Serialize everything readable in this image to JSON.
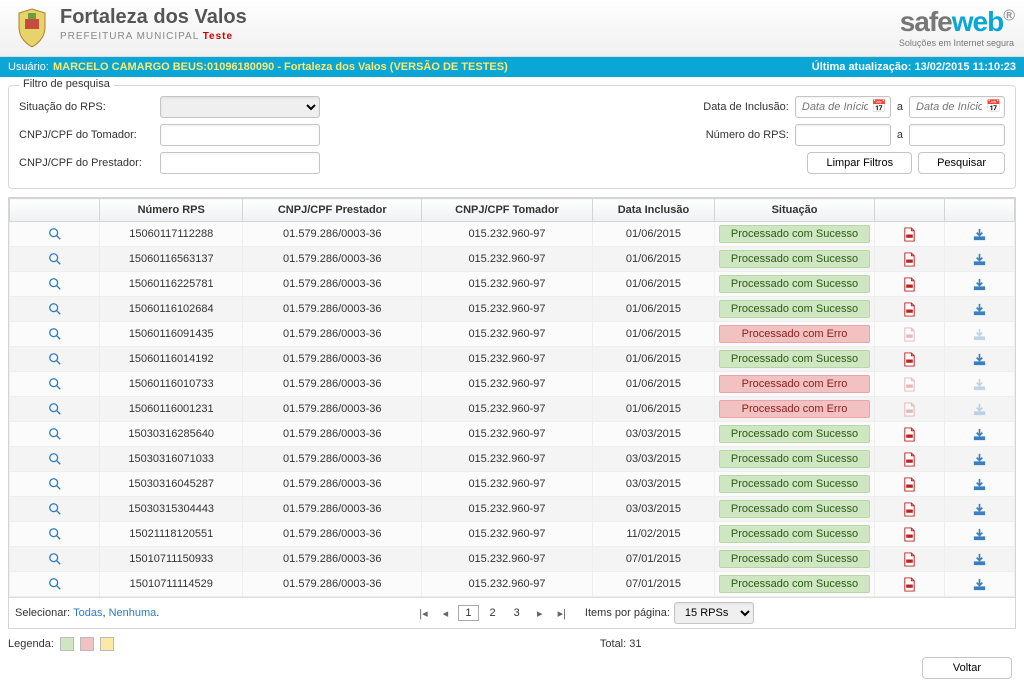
{
  "header": {
    "title": "Fortaleza dos Valos",
    "subtitle": "PREFEITURA MUNICIPAL",
    "teste": "Teste",
    "logo_tag": "Soluções em Internet segura"
  },
  "userbar": {
    "label": "Usuário:",
    "value": "MARCELO CAMARGO BEUS:01096180090 - Fortaleza dos Valos (VERSÃO DE TESTES)",
    "update": "Última atualização: 13/02/2015 11:10:23"
  },
  "filter": {
    "legend": "Filtro de pesquisa",
    "situacao_label": "Situação do RPS:",
    "cnpj_tomador_label": "CNPJ/CPF do Tomador:",
    "cnpj_prestador_label": "CNPJ/CPF do Prestador:",
    "data_inclusao_label": "Data de Inclusão:",
    "numero_rps_label": "Número do RPS:",
    "date_placeholder": "Data de Início",
    "a": "a",
    "limpar": "Limpar Filtros",
    "pesquisar": "Pesquisar"
  },
  "cols": {
    "c1": "",
    "c2": "Número RPS",
    "c3": "CNPJ/CPF Prestador",
    "c4": "CNPJ/CPF Tomador",
    "c5": "Data Inclusão",
    "c6": "Situação",
    "c7": "",
    "c8": ""
  },
  "status": {
    "ok": "Processado com Sucesso",
    "err": "Processado com Erro"
  },
  "rows": [
    {
      "n": "15060117112288",
      "p": "01.579.286/0003-36",
      "t": "015.232.960-97",
      "d": "01/06/2015",
      "s": "ok"
    },
    {
      "n": "15060116563137",
      "p": "01.579.286/0003-36",
      "t": "015.232.960-97",
      "d": "01/06/2015",
      "s": "ok"
    },
    {
      "n": "15060116225781",
      "p": "01.579.286/0003-36",
      "t": "015.232.960-97",
      "d": "01/06/2015",
      "s": "ok"
    },
    {
      "n": "15060116102684",
      "p": "01.579.286/0003-36",
      "t": "015.232.960-97",
      "d": "01/06/2015",
      "s": "ok"
    },
    {
      "n": "15060116091435",
      "p": "01.579.286/0003-36",
      "t": "015.232.960-97",
      "d": "01/06/2015",
      "s": "err"
    },
    {
      "n": "15060116014192",
      "p": "01.579.286/0003-36",
      "t": "015.232.960-97",
      "d": "01/06/2015",
      "s": "ok"
    },
    {
      "n": "15060116010733",
      "p": "01.579.286/0003-36",
      "t": "015.232.960-97",
      "d": "01/06/2015",
      "s": "err"
    },
    {
      "n": "15060116001231",
      "p": "01.579.286/0003-36",
      "t": "015.232.960-97",
      "d": "01/06/2015",
      "s": "err"
    },
    {
      "n": "15030316285640",
      "p": "01.579.286/0003-36",
      "t": "015.232.960-97",
      "d": "03/03/2015",
      "s": "ok"
    },
    {
      "n": "15030316071033",
      "p": "01.579.286/0003-36",
      "t": "015.232.960-97",
      "d": "03/03/2015",
      "s": "ok"
    },
    {
      "n": "15030316045287",
      "p": "01.579.286/0003-36",
      "t": "015.232.960-97",
      "d": "03/03/2015",
      "s": "ok"
    },
    {
      "n": "15030315304443",
      "p": "01.579.286/0003-36",
      "t": "015.232.960-97",
      "d": "03/03/2015",
      "s": "ok"
    },
    {
      "n": "15021118120551",
      "p": "01.579.286/0003-36",
      "t": "015.232.960-97",
      "d": "11/02/2015",
      "s": "ok"
    },
    {
      "n": "15010711150933",
      "p": "01.579.286/0003-36",
      "t": "015.232.960-97",
      "d": "07/01/2015",
      "s": "ok"
    },
    {
      "n": "15010711114529",
      "p": "01.579.286/0003-36",
      "t": "015.232.960-97",
      "d": "07/01/2015",
      "s": "ok"
    }
  ],
  "selbar": {
    "sel": "Selecionar:",
    "todas": "Todas",
    "nenhuma": "Nenhuma",
    "items_label": "Items por página:",
    "items_val": "15 RPSs"
  },
  "pages": {
    "p1": "1",
    "p2": "2",
    "p3": "3"
  },
  "legend": {
    "label": "Legenda:",
    "total": "Total: 31"
  },
  "voltar": "Voltar"
}
